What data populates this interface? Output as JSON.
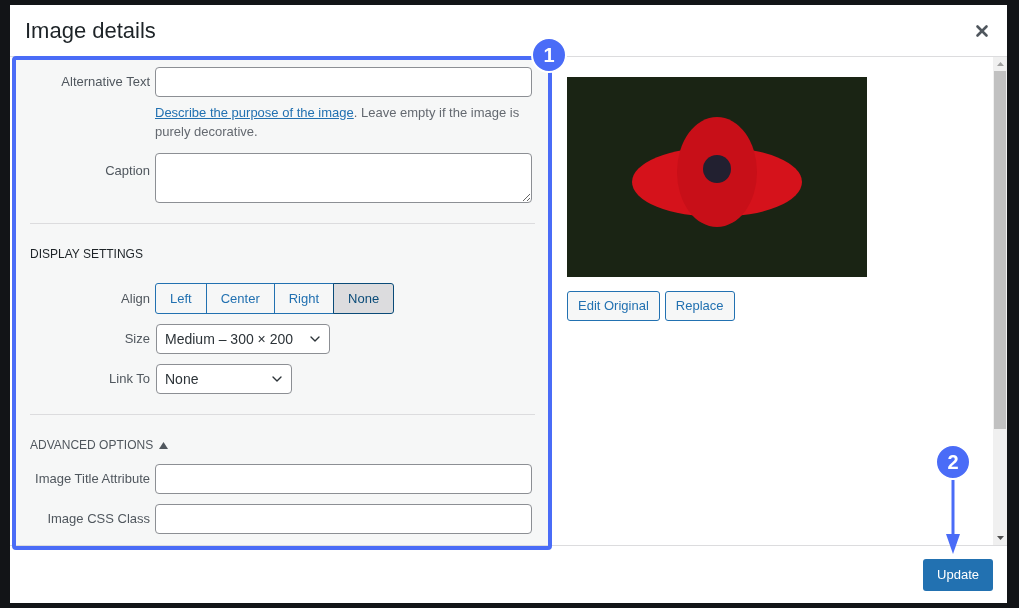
{
  "dialog": {
    "title": "Image details"
  },
  "image_fields": [
    {
      "label": "Alternative Text",
      "kind": "input"
    },
    {
      "kind": "help",
      "link": "Describe the purpose of the image",
      "text": ". Leave empty if the image is purely decorative."
    },
    {
      "label": "Caption",
      "kind": "textarea"
    }
  ],
  "display_settings": {
    "heading": "DISPLAY SETTINGS",
    "align": {
      "label": "Align",
      "options": [
        {
          "label": "Left",
          "selected": false
        },
        {
          "label": "Center",
          "selected": false
        },
        {
          "label": "Right",
          "selected": false
        },
        {
          "label": "None",
          "selected": true
        }
      ]
    },
    "size": {
      "label": "Size",
      "value": "Medium – 300 × 200"
    },
    "link_to": {
      "label": "Link To",
      "value": "None"
    }
  },
  "advanced_options": {
    "heading": "ADVANCED OPTIONS",
    "expanded": true,
    "fields": [
      {
        "label": "Image Title Attribute"
      },
      {
        "label": "Image CSS Class"
      }
    ]
  },
  "image_buttons": [
    "Edit Original",
    "Replace"
  ],
  "footer": {
    "button": "Update"
  },
  "annotations": [
    "1",
    "2"
  ]
}
